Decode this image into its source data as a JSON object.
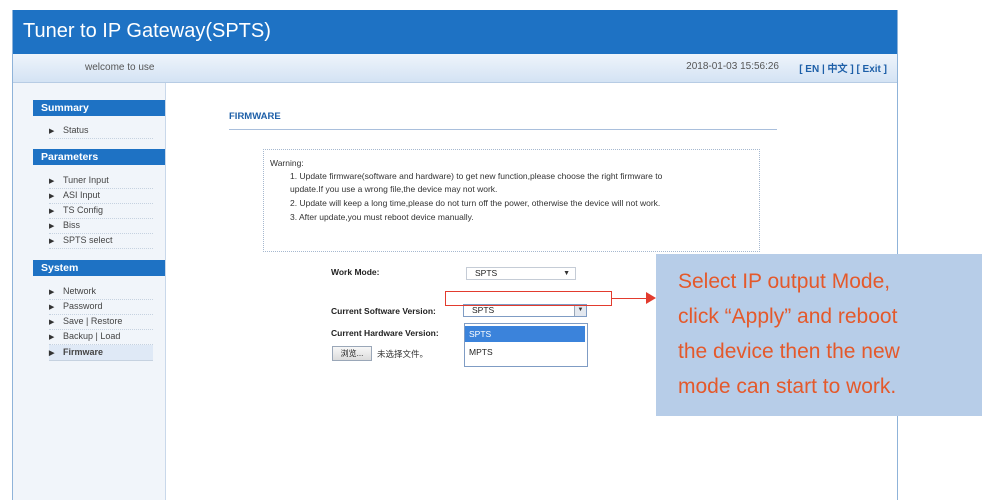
{
  "header": {
    "title": "Tuner to IP Gateway(SPTS)",
    "welcome": "welcome to use",
    "datetime": "2018-01-03 15:56:26",
    "lang_en": "[ EN |",
    "lang_cn": "中文 ]",
    "exit": "[ Exit ]"
  },
  "sidebar": {
    "summary": {
      "title": "Summary",
      "items": [
        "Status"
      ]
    },
    "parameters": {
      "title": "Parameters",
      "items": [
        "Tuner Input",
        "ASI Input",
        "TS Config",
        "Biss",
        "SPTS select"
      ]
    },
    "system": {
      "title": "System",
      "items": [
        "Network",
        "Password",
        "Save | Restore",
        "Backup | Load",
        "Firmware"
      ]
    }
  },
  "main": {
    "section_title": "FIRMWARE",
    "warning": {
      "heading": "Warning:",
      "lines": [
        "1. Update firmware(software and hardware) to get new function,please choose the right firmware to",
        "update.If you use a wrong file,the device may not work.",
        "2. Update will keep a long time,please do not turn off the power, otherwise the device will not work.",
        "3. After update,you must reboot device manually."
      ]
    },
    "work_mode_label": "Work Mode:",
    "work_mode_value": "SPTS",
    "sw_version_label": "Current Software Version:",
    "sw_version_value": "SPTS",
    "hw_version_label": "Current Hardware Version:",
    "dropdown_options": [
      "SPTS",
      "MPTS"
    ],
    "browse_label": "浏览...",
    "no_file_label": "未选择文件。"
  },
  "callout": {
    "lines": [
      "Select IP output Mode,",
      "click “Apply” and reboot",
      "the device then the new",
      "mode can start to work."
    ]
  },
  "colors": {
    "header_blue": "#1e72c4",
    "annotation_red": "#e23b2e",
    "callout_bg": "#b7cde8",
    "callout_text": "#e4592b",
    "selected_option": "#3b83db"
  },
  "icons": {
    "nav_bullet": "triangle-right-icon",
    "select_caret": "chevron-down-icon",
    "annotation_arrow": "arrow-right-icon"
  }
}
